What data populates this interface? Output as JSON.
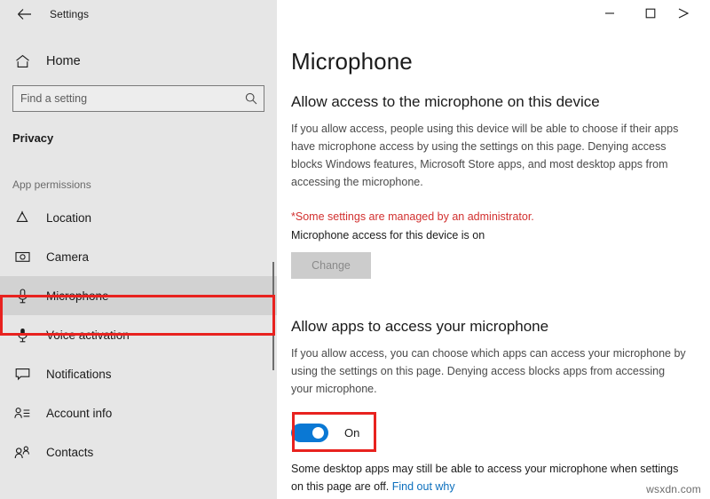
{
  "window": {
    "app_title": "Settings",
    "back_icon": "back-arrow-icon",
    "minimize_label": "Minimize",
    "maximize_label": "Maximize",
    "close_label": "Close"
  },
  "sidebar": {
    "home_label": "Home",
    "home_icon": "home-icon",
    "search": {
      "placeholder": "Find a setting",
      "value": "",
      "icon": "search-icon"
    },
    "section_title": "Privacy",
    "group_label": "App permissions",
    "items": [
      {
        "label": "Location",
        "icon": "location-icon",
        "selected": false
      },
      {
        "label": "Camera",
        "icon": "camera-icon",
        "selected": false
      },
      {
        "label": "Microphone",
        "icon": "microphone-icon",
        "selected": true
      },
      {
        "label": "Voice activation",
        "icon": "voice-activation-icon",
        "selected": false
      },
      {
        "label": "Notifications",
        "icon": "notification-icon",
        "selected": false
      },
      {
        "label": "Account info",
        "icon": "account-info-icon",
        "selected": false
      },
      {
        "label": "Contacts",
        "icon": "contacts-icon",
        "selected": false
      }
    ]
  },
  "main": {
    "page_title": "Microphone",
    "device_section": {
      "heading": "Allow access to the microphone on this device",
      "description": "If you allow access, people using this device will be able to choose if their apps have microphone access by using the settings on this page. Denying access blocks Windows features, Microsoft Store apps, and most desktop apps from accessing the microphone.",
      "admin_note": "*Some settings are managed by an administrator.",
      "status": "Microphone access for this device is on",
      "change_button": "Change"
    },
    "apps_section": {
      "heading": "Allow apps to access your microphone",
      "description": "If you allow access, you can choose which apps can access your microphone by using the settings on this page. Denying access blocks apps from accessing your microphone.",
      "toggle_state": "On",
      "footnote_text": "Some desktop apps may still be able to access your microphone when settings on this page are off. ",
      "footnote_link": "Find out why"
    }
  },
  "watermark": "wsxdn.com",
  "colors": {
    "accent": "#0a78d4",
    "annotation": "#e8221f",
    "admin_note": "#d2302f",
    "link": "#0a6ebd",
    "sidebar_bg": "#e6e6e6",
    "selected_bg": "#d2d2d2"
  }
}
